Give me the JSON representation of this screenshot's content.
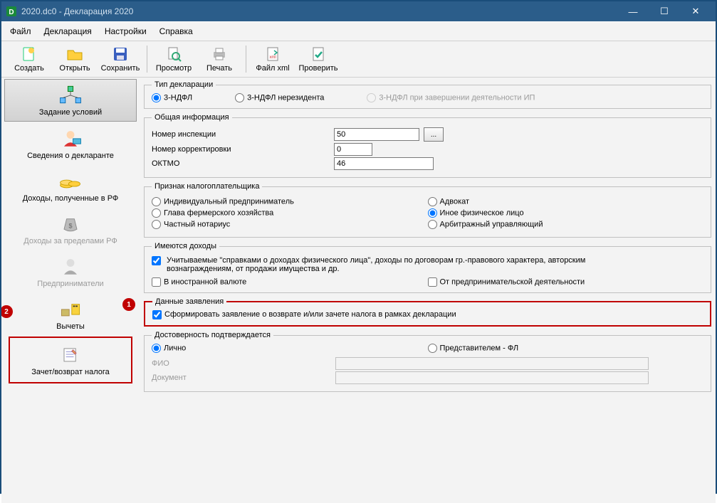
{
  "window": {
    "title": "2020.dc0 - Декларация 2020"
  },
  "menu": {
    "file": "Файл",
    "declaration": "Декларация",
    "settings": "Настройки",
    "help": "Справка"
  },
  "toolbar": {
    "create": "Создать",
    "open": "Открыть",
    "save": "Сохранить",
    "preview": "Просмотр",
    "print": "Печать",
    "xml": "Файл xml",
    "check": "Проверить"
  },
  "sidebar": {
    "conditions": "Задание условий",
    "declarant": "Сведения о декларанте",
    "income_rf": "Доходы, полученные в РФ",
    "income_abroad": "Доходы за пределами РФ",
    "entrepreneurs": "Предприниматели",
    "deductions": "Вычеты",
    "refund": "Зачет/возврат налога"
  },
  "badges": {
    "one": "2",
    "two": "1"
  },
  "groups": {
    "decl_type": {
      "legend": "Тип декларации",
      "opt1": "3-НДФЛ",
      "opt2": "3-НДФЛ нерезидента",
      "opt3": "3-НДФЛ при завершении деятельности ИП"
    },
    "general": {
      "legend": "Общая информация",
      "inspection": "Номер инспекции",
      "inspection_val": "50",
      "correction": "Номер корректировки",
      "correction_val": "0",
      "oktmo": "ОКТМО",
      "oktmo_val": "46",
      "browse": "..."
    },
    "taxpayer": {
      "legend": "Признак налогоплательщика",
      "ip": "Индивидуальный предприниматель",
      "advocate": "Адвокат",
      "farmer": "Глава фермерского хозяйства",
      "individual": "Иное физическое лицо",
      "notary": "Частный нотариус",
      "arbitr": "Арбитражный управляющий"
    },
    "income": {
      "legend": "Имеются доходы",
      "cert": "Учитываемые \"справками о доходах физического лица\", доходы по договорам гр.-правового характера, авторским вознаграждениям, от продажи имущества и др.",
      "foreign": "В иностранной валюте",
      "entrepreneur": "От предпринимательской деятельности"
    },
    "application": {
      "legend": "Данные заявления",
      "form": "Сформировать заявление о  возврате и/или зачете налога в рамках декларации"
    },
    "authenticity": {
      "legend": "Достоверность подтверждается",
      "personal": "Лично",
      "representative": "Представителем - ФЛ",
      "fio": "ФИО",
      "doc": "Документ"
    }
  }
}
